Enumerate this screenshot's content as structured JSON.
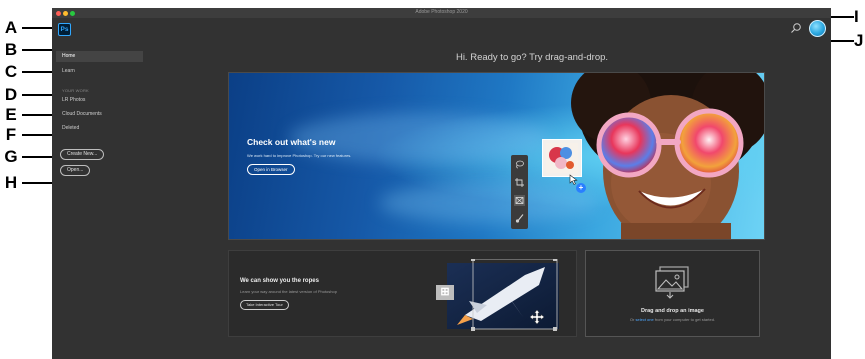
{
  "callouts": {
    "left": [
      "A",
      "B",
      "C",
      "D",
      "E",
      "F",
      "G",
      "H"
    ],
    "right": [
      "I",
      "J"
    ]
  },
  "window": {
    "title": "Adobe Photoshop 2020",
    "traffic_colors": [
      "#ff5f57",
      "#febc2e",
      "#28c840"
    ]
  },
  "app": {
    "logo_text": "Ps",
    "logo_icon": "photoshop-logo-icon",
    "search_icon": "search-icon",
    "avatar_icon": "user-avatar-icon"
  },
  "sidebar": {
    "items": [
      {
        "label": "Home",
        "active": true
      },
      {
        "label": "Learn",
        "active": false
      }
    ],
    "section_label": "YOUR WORK",
    "work_items": [
      {
        "label": "LR Photos"
      },
      {
        "label": "Cloud Documents"
      },
      {
        "label": "Deleted"
      }
    ],
    "create_button": "Create New...",
    "open_button": "Open..."
  },
  "main": {
    "headline": "Hi. Ready to go? Try drag-and-drop."
  },
  "hero": {
    "title": "Check out what's new",
    "subtitle": "We work hard to improve Photoshop. Try our new features.",
    "button": "Open in Browser",
    "accent_color": "#2a7fff"
  },
  "tour_card": {
    "title": "We can show you the ropes",
    "subtitle": "Learn your way around the latest version of Photoshop",
    "button": "Take Interactive Tour"
  },
  "drop_card": {
    "icon": "image-drop-icon",
    "title": "Drag and drop an image",
    "subtitle_prefix": "Or ",
    "subtitle_link": "select one",
    "subtitle_suffix": " from your computer to get started."
  }
}
